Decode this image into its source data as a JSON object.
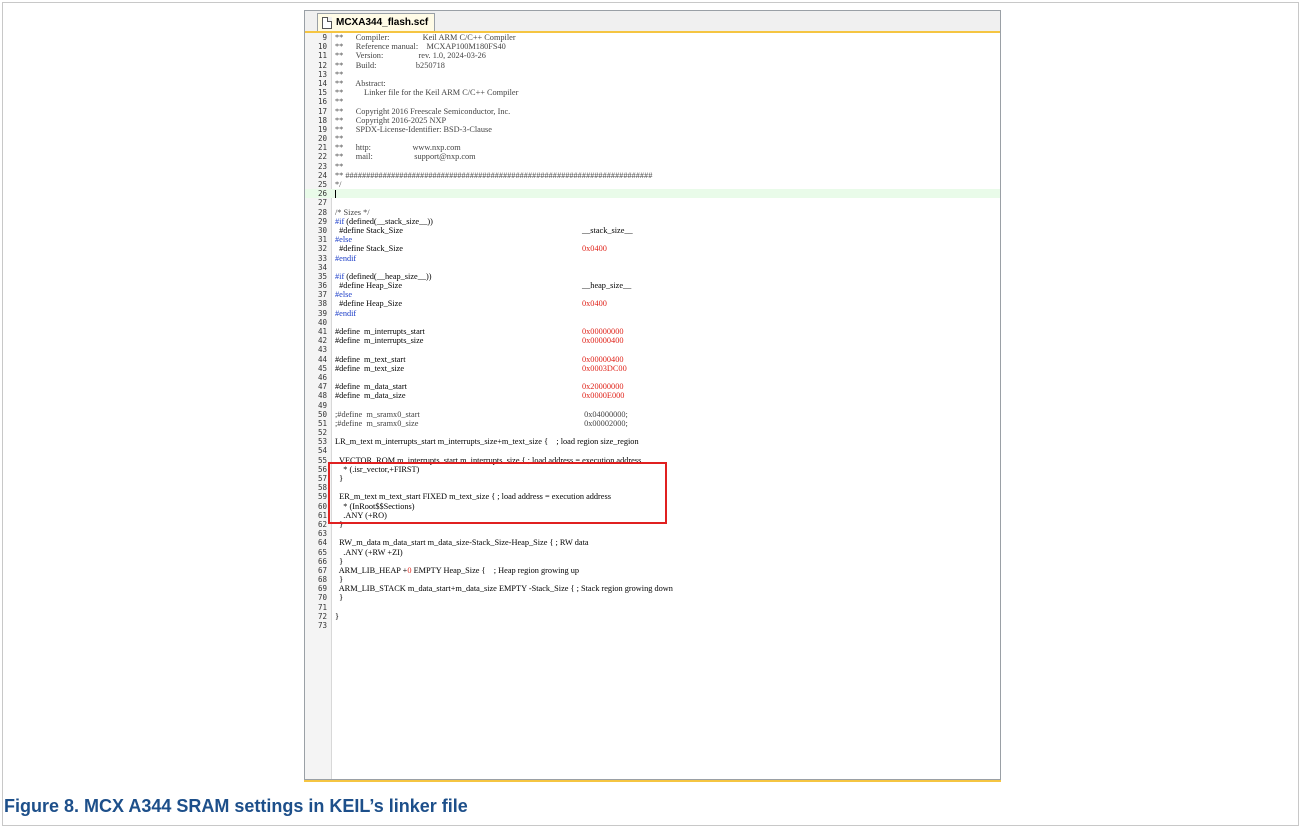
{
  "editor": {
    "tab_label": "MCXA344_flash.scf",
    "lines": [
      {
        "n": "9",
        "code": "**      Compiler:                Keil ARM C/C++ Compiler",
        "cls": "cmt"
      },
      {
        "n": "10",
        "code": "**      Reference manual:    MCXAP100M180FS40",
        "cls": "cmt"
      },
      {
        "n": "11",
        "code": "**      Version:                 rev. 1.0, 2024-03-26",
        "cls": "cmt"
      },
      {
        "n": "12",
        "code": "**      Build:                   b250718",
        "cls": "cmt"
      },
      {
        "n": "13",
        "code": "**",
        "cls": "cmt"
      },
      {
        "n": "14",
        "code": "**      Abstract:",
        "cls": "cmt"
      },
      {
        "n": "15",
        "code": "**          Linker file for the Keil ARM C/C++ Compiler",
        "cls": "cmt"
      },
      {
        "n": "16",
        "code": "**",
        "cls": "cmt"
      },
      {
        "n": "17",
        "code": "**      Copyright 2016 Freescale Semiconductor, Inc.",
        "cls": "cmt"
      },
      {
        "n": "18",
        "code": "**      Copyright 2016-2025 NXP",
        "cls": "cmt"
      },
      {
        "n": "19",
        "code": "**      SPDX-License-Identifier: BSD-3-Clause",
        "cls": "cmt"
      },
      {
        "n": "20",
        "code": "**",
        "cls": "cmt"
      },
      {
        "n": "21",
        "code": "**      http:                    www.nxp.com",
        "cls": "cmt"
      },
      {
        "n": "22",
        "code": "**      mail:                    support@nxp.com",
        "cls": "cmt"
      },
      {
        "n": "23",
        "code": "**",
        "cls": "cmt"
      },
      {
        "n": "24",
        "code": "** ##########################################################################",
        "cls": "cmt"
      },
      {
        "n": "25",
        "code": "*/",
        "cls": "cmt"
      },
      {
        "n": "26",
        "code": "",
        "cls": "current"
      },
      {
        "n": "27",
        "code": "",
        "cls": ""
      },
      {
        "n": "28",
        "code": "/* Sizes */",
        "cls": "cmt"
      },
      {
        "n": "29",
        "code": "#if (defined(__stack_size__))",
        "cls": "kwline"
      },
      {
        "n": "30",
        "code": "  #define Stack_Size",
        "val": "__stack_size__",
        "cls": ""
      },
      {
        "n": "31",
        "code": "#else",
        "cls": "kw"
      },
      {
        "n": "32",
        "code": "  #define Stack_Size",
        "val": "0x0400",
        "valcls": "red",
        "cls": ""
      },
      {
        "n": "33",
        "code": "#endif",
        "cls": "kw"
      },
      {
        "n": "34",
        "code": "",
        "cls": ""
      },
      {
        "n": "35",
        "code": "#if (defined(__heap_size__))",
        "cls": "kwline"
      },
      {
        "n": "36",
        "code": "  #define Heap_Size",
        "val": "__heap_size__",
        "cls": ""
      },
      {
        "n": "37",
        "code": "#else",
        "cls": "kw"
      },
      {
        "n": "38",
        "code": "  #define Heap_Size",
        "val": "0x0400",
        "valcls": "red",
        "cls": ""
      },
      {
        "n": "39",
        "code": "#endif",
        "cls": "kw"
      },
      {
        "n": "40",
        "code": "",
        "cls": ""
      },
      {
        "n": "41",
        "code": "#define  m_interrupts_start",
        "val": "0x00000000",
        "valcls": "red",
        "cls": ""
      },
      {
        "n": "42",
        "code": "#define  m_interrupts_size",
        "val": "0x00000400",
        "valcls": "red",
        "cls": ""
      },
      {
        "n": "43",
        "code": "",
        "cls": ""
      },
      {
        "n": "44",
        "code": "#define  m_text_start",
        "val": "0x00000400",
        "valcls": "red",
        "cls": ""
      },
      {
        "n": "45",
        "code": "#define  m_text_size",
        "val": "0x0003DC00",
        "valcls": "red",
        "cls": ""
      },
      {
        "n": "46",
        "code": "",
        "cls": ""
      },
      {
        "n": "47",
        "code": "#define  m_data_start",
        "val": "0x20000000",
        "valcls": "red",
        "cls": ""
      },
      {
        "n": "48",
        "code": "#define  m_data_size",
        "val": "0x0000E000",
        "valcls": "red",
        "cls": ""
      },
      {
        "n": "49",
        "code": "",
        "cls": ""
      },
      {
        "n": "50",
        "code": ";#define  m_sramx0_start",
        "val": " 0x04000000;",
        "cls": "cmt"
      },
      {
        "n": "51",
        "code": ";#define  m_sramx0_size",
        "val": " 0x00002000;",
        "cls": "cmt"
      },
      {
        "n": "52",
        "code": "",
        "cls": ""
      },
      {
        "n": "53",
        "code": "LR_m_text m_interrupts_start m_interrupts_size+m_text_size {    ; load region size_region",
        "cls": ""
      },
      {
        "n": "54",
        "code": "",
        "cls": ""
      },
      {
        "n": "55",
        "code": "  VECTOR_ROM m_interrupts_start m_interrupts_size { ; load address = execution address",
        "cls": ""
      },
      {
        "n": "56",
        "code": "    * (.isr_vector,+FIRST)",
        "cls": ""
      },
      {
        "n": "57",
        "code": "  }",
        "cls": ""
      },
      {
        "n": "58",
        "code": "",
        "cls": ""
      },
      {
        "n": "59",
        "code": "  ER_m_text m_text_start FIXED m_text_size { ; load address = execution address",
        "cls": ""
      },
      {
        "n": "60",
        "code": "    * (InRoot$$Sections)",
        "cls": ""
      },
      {
        "n": "61",
        "code": "    .ANY (+RO)",
        "cls": ""
      },
      {
        "n": "62",
        "code": "  }",
        "cls": ""
      },
      {
        "n": "63",
        "code": "",
        "cls": ""
      },
      {
        "n": "64",
        "code": "  RW_m_data m_data_start m_data_size-Stack_Size-Heap_Size { ; RW data",
        "cls": ""
      },
      {
        "n": "65",
        "code": "    .ANY (+RW +ZI)",
        "cls": ""
      },
      {
        "n": "66",
        "code": "  }",
        "cls": ""
      },
      {
        "n": "67",
        "code": "  ARM_LIB_HEAP +0 EMPTY Heap_Size {    ; Heap region growing up",
        "cls": ""
      },
      {
        "n": "68",
        "code": "  }",
        "cls": ""
      },
      {
        "n": "69",
        "code": "  ARM_LIB_STACK m_data_start+m_data_size EMPTY -Stack_Size { ; Stack region growing down",
        "cls": ""
      },
      {
        "n": "70",
        "code": "  }",
        "cls": ""
      },
      {
        "n": "71",
        "code": "",
        "cls": ""
      },
      {
        "n": "72",
        "code": "}",
        "cls": ""
      },
      {
        "n": "73",
        "code": "",
        "cls": ""
      }
    ]
  },
  "caption": "Figure 8.  MCX A344 SRAM settings in KEIL’s linker file",
  "colors": {
    "highlight_box": "#e02020",
    "caption": "#1d4f8a",
    "value_red": "#e0241b",
    "keyword_blue": "#1a3cc8",
    "current_line": "#e9fbe9"
  }
}
